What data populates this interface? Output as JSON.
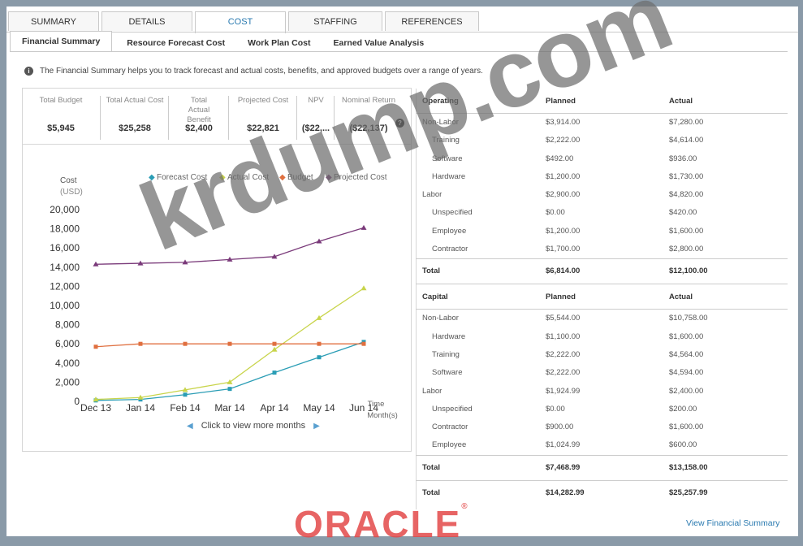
{
  "tabs": [
    "SUMMARY",
    "DETAILS",
    "COST",
    "STAFFING",
    "REFERENCES"
  ],
  "active_tab": "COST",
  "subtabs": [
    "Financial Summary",
    "Resource Forecast Cost",
    "Work Plan Cost",
    "Earned Value Analysis"
  ],
  "active_subtab": "Financial Summary",
  "info_text": "The Financial Summary helps you to track forecast and actual costs, benefits, and approved budgets over a range of years.",
  "kpis": [
    {
      "label": "Total Budget",
      "value": "$5,945"
    },
    {
      "label": "Total Actual Cost",
      "value": "$25,258"
    },
    {
      "label": "Total Actual Benefit",
      "value": "$2,400"
    },
    {
      "label": "Projected Cost",
      "value": "$22,821"
    },
    {
      "label": "NPV",
      "value": "($22,..."
    },
    {
      "label": "Nominal Return",
      "value": "($22,137)"
    }
  ],
  "chart_data": {
    "type": "line",
    "ylabel": "Cost (USD)",
    "xlabel": "Time Month(s)",
    "categories": [
      "Dec 13",
      "Jan 14",
      "Feb 14",
      "Mar 14",
      "Apr 14",
      "May 14",
      "Jun 14"
    ],
    "ylim": [
      0,
      20000
    ],
    "yticks": [
      "20,000",
      "18,000",
      "16,000",
      "14,000",
      "12,000",
      "10,000",
      "8,000",
      "6,000",
      "4,000",
      "2,000",
      "0"
    ],
    "legend_position": "top",
    "series": [
      {
        "name": "Forecast Cost",
        "color": "#2a9db5",
        "marker": "square",
        "values": [
          100,
          200,
          700,
          1300,
          3000,
          4600,
          6200
        ]
      },
      {
        "name": "Actual Cost",
        "color": "#c8d44a",
        "marker": "triangle",
        "values": [
          200,
          400,
          1200,
          2000,
          5400,
          8700,
          11800
        ]
      },
      {
        "name": "Budget",
        "color": "#e07040",
        "marker": "square",
        "values": [
          5700,
          6000,
          6000,
          6000,
          6000,
          6000,
          6000
        ]
      },
      {
        "name": "Projected Cost",
        "color": "#7a3a7a",
        "marker": "triangle",
        "values": [
          14300,
          14400,
          14500,
          14800,
          15100,
          16700,
          18100
        ]
      }
    ]
  },
  "more_months": "Click to view more months",
  "operating": {
    "header": [
      "Operating",
      "Planned",
      "Actual"
    ],
    "rows": [
      [
        "Non-Labor",
        "$3,914.00",
        "$7,280.00"
      ],
      [
        "Training",
        "$2,222.00",
        "$4,614.00"
      ],
      [
        "Software",
        "$492.00",
        "$936.00"
      ],
      [
        "Hardware",
        "$1,200.00",
        "$1,730.00"
      ],
      [
        "Labor",
        "$2,900.00",
        "$4,820.00"
      ],
      [
        "Unspecified",
        "$0.00",
        "$420.00"
      ],
      [
        "Employee",
        "$1,200.00",
        "$1,600.00"
      ],
      [
        "Contractor",
        "$1,700.00",
        "$2,800.00"
      ]
    ],
    "total": [
      "Total",
      "$6,814.00",
      "$12,100.00"
    ]
  },
  "capital": {
    "header": [
      "Capital",
      "Planned",
      "Actual"
    ],
    "rows": [
      [
        "Non-Labor",
        "$5,544.00",
        "$10,758.00"
      ],
      [
        "Hardware",
        "$1,100.00",
        "$1,600.00"
      ],
      [
        "Training",
        "$2,222.00",
        "$4,564.00"
      ],
      [
        "Software",
        "$2,222.00",
        "$4,594.00"
      ],
      [
        "Labor",
        "$1,924.99",
        "$2,400.00"
      ],
      [
        "Unspecified",
        "$0.00",
        "$200.00"
      ],
      [
        "Contractor",
        "$900.00",
        "$1,600.00"
      ],
      [
        "Employee",
        "$1,024.99",
        "$600.00"
      ]
    ],
    "total": [
      "Total",
      "$7,468.99",
      "$13,158.00"
    ]
  },
  "grand_total": [
    "Total",
    "$14,282.99",
    "$25,257.99"
  ],
  "view_link": "View Financial Summary",
  "watermark": "krdump.com",
  "logo": "ORACLE"
}
